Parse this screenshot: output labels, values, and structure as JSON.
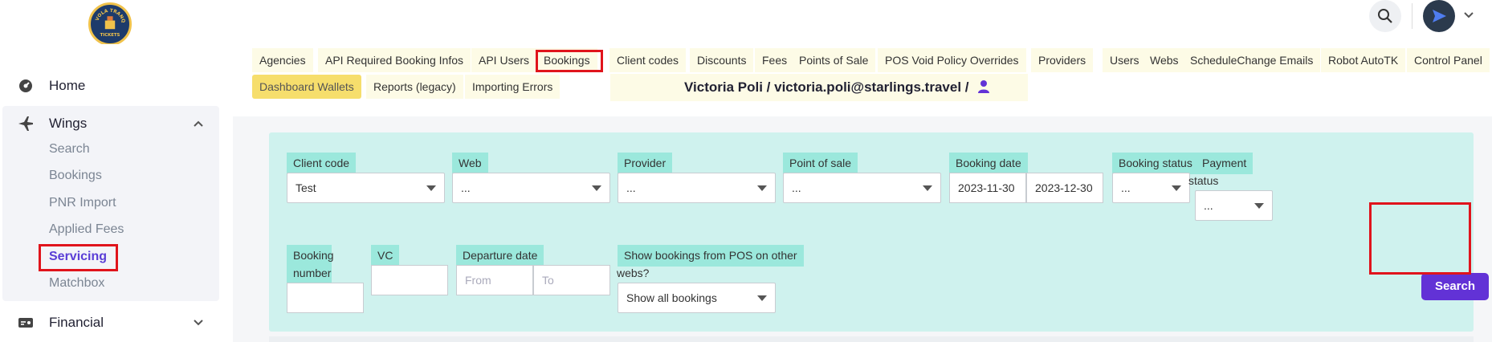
{
  "app": {
    "logo_text": "VOLA TRANQUI TICKETS"
  },
  "topbar": {
    "search_icon": "search-icon",
    "avatar_icon": "paper-plane-icon"
  },
  "sidebar": {
    "home": {
      "label": "Home",
      "icon": "dashboard-icon"
    },
    "wings": {
      "label": "Wings",
      "icon": "airplane-icon",
      "items": [
        {
          "label": "Search"
        },
        {
          "label": "Bookings"
        },
        {
          "label": "PNR Import"
        },
        {
          "label": "Applied Fees"
        },
        {
          "label": "Servicing"
        },
        {
          "label": "Matchbox"
        }
      ]
    },
    "financial": {
      "label": "Financial",
      "icon": "money-icon"
    }
  },
  "tabs": {
    "row1": [
      "Agencies",
      "API Required Booking Infos",
      "API Users",
      "Bookings",
      "Client codes",
      "Discounts",
      "Fees",
      "Points of Sale",
      "POS Void Policy Overrides",
      "Providers",
      "Users",
      "Webs",
      "ScheduleChange Emails",
      "Robot AutoTK",
      "Control Panel"
    ],
    "row2": [
      "Dashboard Wallets",
      "Reports (legacy)",
      "Importing Errors"
    ]
  },
  "user": {
    "text": "Victoria Poli / victoria.poli@starlings.travel /"
  },
  "filters": {
    "client_code": {
      "label": "Client code",
      "value": "Test"
    },
    "web": {
      "label": "Web",
      "value": "..."
    },
    "provider": {
      "label": "Provider",
      "value": "..."
    },
    "point_of_sale": {
      "label": "Point of sale",
      "value": "..."
    },
    "booking_date": {
      "label": "Booking date",
      "from": "2023-11-30",
      "to": "2023-12-30"
    },
    "booking_status": {
      "label": "Booking status",
      "value": "..."
    },
    "payment_status": {
      "label_line1": "Payment",
      "label_line2": "status",
      "value": "..."
    },
    "booking_number": {
      "label_line1": "Booking",
      "label_line2": "number",
      "value": ""
    },
    "vc": {
      "label": "VC",
      "value": ""
    },
    "departure_date": {
      "label": "Departure date",
      "from_placeholder": "From",
      "to_placeholder": "To"
    },
    "pos_other_webs": {
      "label_line1": "Show bookings from POS on other",
      "label_line2": "webs?",
      "value": "Show all bookings"
    },
    "search_button": "Search"
  },
  "colors": {
    "accent": "#6232d6",
    "highlight_red": "#e0141c",
    "panel": "#cff2ee",
    "label_bg": "#9be8dc"
  }
}
